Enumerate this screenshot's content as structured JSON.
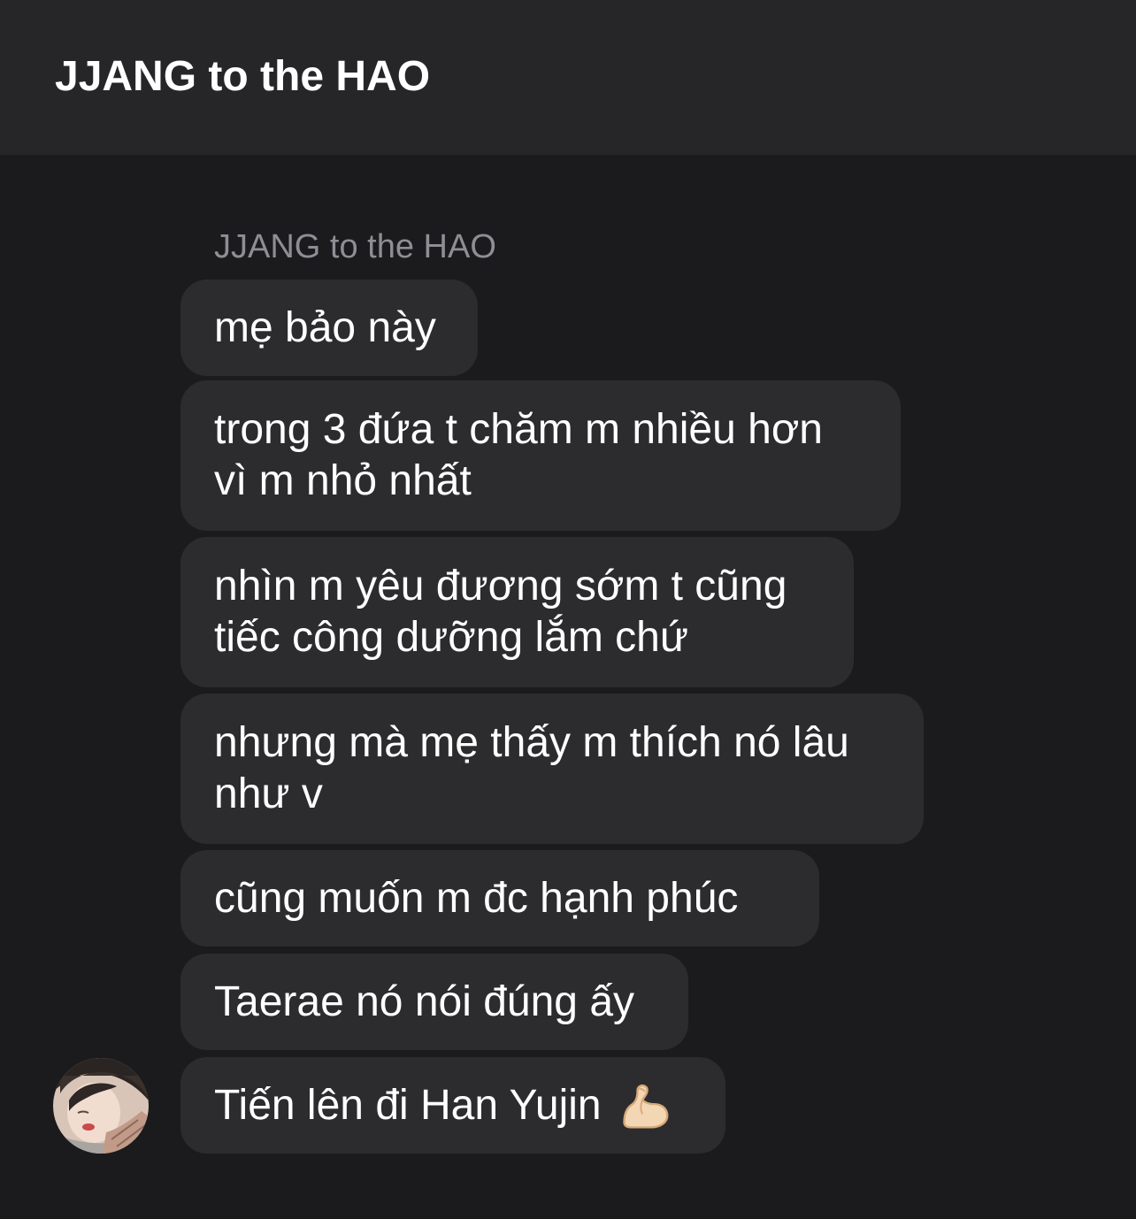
{
  "header": {
    "title": "JJANG to the HAO"
  },
  "conversation": {
    "sender_name": "JJANG to the HAO",
    "messages": [
      {
        "text": "mẹ bảo này"
      },
      {
        "text": "trong 3 đứa t chăm m nhiều hơn\nvì m nhỏ nhất"
      },
      {
        "text": "nhìn m yêu đương sớm t cũng\ntiếc công dưỡng lắm chứ"
      },
      {
        "text": "nhưng mà mẹ thấy m thích nó lâu\nnhư v"
      },
      {
        "text": "cũng muốn m đc hạnh phúc"
      },
      {
        "text": "Taerae nó nói đúng ấy"
      },
      {
        "text": "Tiến lên đi Han Yujin",
        "emoji": "flexed-biceps-icon"
      }
    ]
  },
  "colors": {
    "background": "#1b1b1d",
    "header": "#262628",
    "bubble": "#2c2c2e",
    "text": "#ffffff",
    "sender_name": "#8e8e93"
  }
}
